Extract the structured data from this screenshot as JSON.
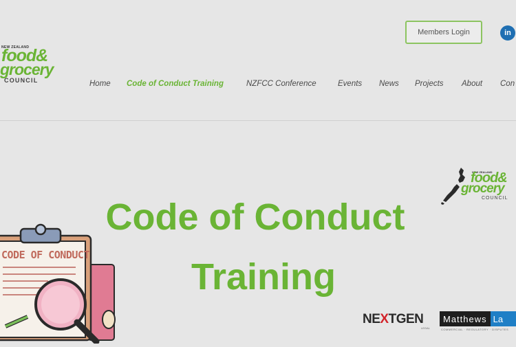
{
  "header": {
    "logo": {
      "tiny": "NEW ZEALAND",
      "food": "food&",
      "grocery": "grocery",
      "council": "COUNCIL"
    },
    "members_login": "Members Login",
    "linkedin": "in",
    "nav": [
      "Home",
      "Code of Conduct Training",
      "NZFCC Conference",
      "Events",
      "News",
      "Projects",
      "About",
      "Con"
    ],
    "active_nav": "Code of Conduct Training"
  },
  "hero": {
    "title_line1": "Code of Conduct",
    "title_line2": "Training",
    "clipboard_text": "CODE OF CONDUCT",
    "hero_logo": {
      "tiny": "NEW ZEALAND",
      "food": "food&",
      "grocery": "grocery",
      "council": "COUNCIL"
    }
  },
  "sponsors": {
    "nextgen_a": "NE",
    "nextgen_x": "X",
    "nextgen_b": "TGEN",
    "nextgen_sub": "LEGAL",
    "matthews": "Matthews",
    "matthews_b": "La",
    "matthews_sub": "COMMERCIAL · REGULATORY · DISPUTES"
  },
  "colors": {
    "brand_green": "#6ab435",
    "background": "#e6e6e6",
    "linkedin_blue": "#1f6fb2"
  }
}
